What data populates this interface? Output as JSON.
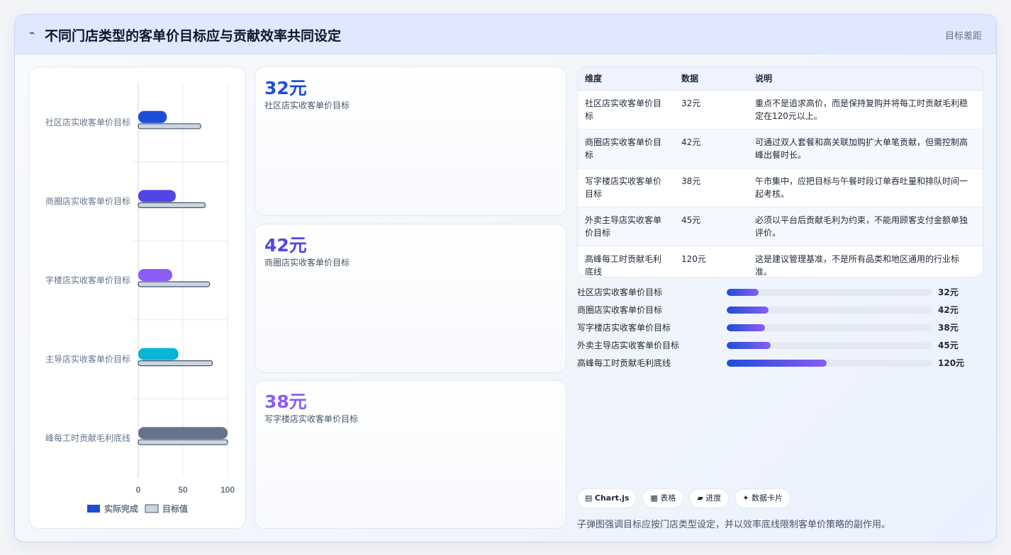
{
  "header": {
    "icon": "pulse-icon",
    "title": "不同门店类型的客单价目标应与贡献效率共同设定",
    "right_label": "目标差距"
  },
  "chart_data": {
    "type": "bar",
    "orientation": "horizontal",
    "categories": [
      "社区店实收客单价目标",
      "商圈店实收客单价目标",
      "字楼店实收客单价目标",
      "主导店实收客单价目标",
      "峰每工时贡献毛利底线"
    ],
    "series": [
      {
        "name": "实际完成",
        "values": [
          32,
          42,
          38,
          45,
          100
        ],
        "colors": [
          "#1d4ed8",
          "#4f46e5",
          "#8b5cf6",
          "#06b6d4",
          "#64748b"
        ]
      },
      {
        "name": "目标值",
        "values": [
          70,
          75,
          80,
          83,
          100
        ],
        "color": "#cbd5e1"
      }
    ],
    "xlim": [
      0,
      100
    ],
    "xticks": [
      "0",
      "50",
      "100"
    ],
    "legend": "bottom",
    "grid": true
  },
  "stats": [
    {
      "value": "32元",
      "label": "社区店实收客单价目标",
      "color": "#1d4ed8"
    },
    {
      "value": "42元",
      "label": "商圈店实收客单价目标",
      "color": "#4f46e5"
    },
    {
      "value": "38元",
      "label": "写字楼店实收客单价目标",
      "color": "#8b5cf6"
    }
  ],
  "table": {
    "headers": [
      "维度",
      "数据",
      "说明"
    ],
    "rows": [
      [
        "社区店实收客单价目标",
        "32元",
        "重点不是追求高价，而是保持复购并将每工时贡献毛利稳定在120元以上。"
      ],
      [
        "商圈店实收客单价目标",
        "42元",
        "可通过双人套餐和高关联加购扩大单笔贡献，但需控制高峰出餐时长。"
      ],
      [
        "写字楼店实收客单价目标",
        "38元",
        "午市集中，应把目标与午餐时段订单吞吐量和排队时间一起考核。"
      ],
      [
        "外卖主导店实收客单价目标",
        "45元",
        "必须以平台后贡献毛利为约束，不能用顾客支付金额单独评价。"
      ],
      [
        "高峰每工时贡献毛利底线",
        "120元",
        "这是建议管理基准，不是所有品类和地区通用的行业标准。"
      ]
    ]
  },
  "progress": [
    {
      "label": "社区店实收客单价目标",
      "value": "32元",
      "fraction": 0.155
    },
    {
      "label": "商圈店实收客单价目标",
      "value": "42元",
      "fraction": 0.205
    },
    {
      "label": "写字楼店实收客单价目标",
      "value": "38元",
      "fraction": 0.185
    },
    {
      "label": "外卖主导店实收客单价目标",
      "value": "45元",
      "fraction": 0.215
    },
    {
      "label": "高峰每工时贡献毛利底线",
      "value": "120元",
      "fraction": 0.485
    }
  ],
  "tags": [
    {
      "icon": "chart-icon",
      "glyph": "▤",
      "label": "Chart.js"
    },
    {
      "icon": "table-icon",
      "glyph": "▦",
      "label": "表格"
    },
    {
      "icon": "progress-icon",
      "glyph": "▰",
      "label": "进度"
    },
    {
      "icon": "sparkle-icon",
      "glyph": "✦",
      "label": "数据卡片"
    }
  ],
  "footer_note": "子弹图强调目标应按门店类型设定，并以效率底线限制客单价策略的副作用。"
}
